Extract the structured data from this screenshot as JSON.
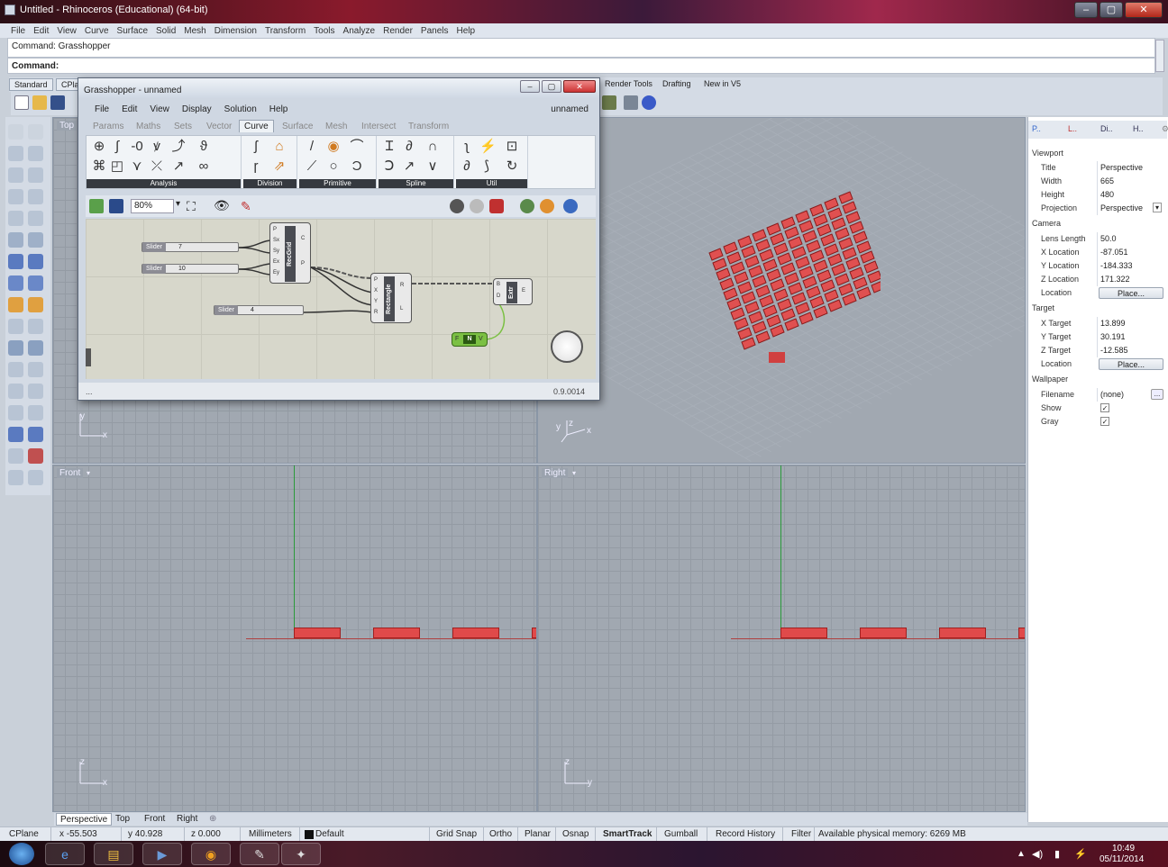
{
  "window": {
    "title": "Untitled - Rhinoceros (Educational) (64-bit)",
    "min": "–",
    "max": "▢",
    "close": "✕"
  },
  "menu": [
    "File",
    "Edit",
    "View",
    "Curve",
    "Surface",
    "Solid",
    "Mesh",
    "Dimension",
    "Transform",
    "Tools",
    "Analyze",
    "Render",
    "Panels",
    "Help"
  ],
  "command": {
    "history": "Command: Grasshopper",
    "prompt": "Command:"
  },
  "toolbar_tabs": {
    "standard": "Standard",
    "cplanes": "CPla",
    "render_tools": "Render Tools",
    "drafting": "Drafting",
    "new_v5": "New in V5"
  },
  "viewports": {
    "top": {
      "label": "Top",
      "ax_y": "y",
      "ax_x": "x"
    },
    "perspective": {
      "ax_z": "z",
      "ax_y": "y",
      "ax_x": "x"
    },
    "front": {
      "label": "Front",
      "ax_z": "z",
      "ax_x": "x"
    },
    "right": {
      "label": "Right",
      "ax_z": "z",
      "ax_y": "y"
    }
  },
  "grasshopper": {
    "title": "Grasshopper - unnamed",
    "doc": "unnamed",
    "menu": [
      "File",
      "Edit",
      "View",
      "Display",
      "Solution",
      "Help"
    ],
    "tabs": [
      "Params",
      "Maths",
      "Sets",
      "Vector",
      "Curve",
      "Surface",
      "Mesh",
      "Intersect",
      "Transform"
    ],
    "active_tab": "Curve",
    "groups": [
      "Analysis",
      "Division",
      "Primitive",
      "Spline",
      "Util"
    ],
    "zoom": "80%",
    "version": "0.9.0014",
    "status_left": "...",
    "sliders": [
      {
        "label": "Slider",
        "value": "7"
      },
      {
        "label": "Slider",
        "value": "10"
      },
      {
        "label": "Slider",
        "value": "4"
      }
    ],
    "components": {
      "recgrid": {
        "name": "RecGrid",
        "inputs": [
          "P",
          "Sx",
          "Sy",
          "Ex",
          "Ey"
        ],
        "outputs": [
          "C",
          "P"
        ]
      },
      "rectangle": {
        "name": "Rectangle",
        "inputs": [
          "P",
          "X",
          "Y",
          "R"
        ],
        "outputs": [
          "R",
          "L"
        ]
      },
      "extr": {
        "name": "Extr",
        "inputs": [
          "B",
          "D"
        ],
        "outputs": [
          "E"
        ]
      },
      "vector": {
        "name": "N",
        "inputs": [
          "F"
        ],
        "outputs": [
          "V"
        ]
      }
    }
  },
  "properties": {
    "tabs": [
      "P..",
      "L..",
      "Di..",
      "H.."
    ],
    "viewport_section": "Viewport",
    "viewport": [
      {
        "k": "Title",
        "v": "Perspective"
      },
      {
        "k": "Width",
        "v": "665"
      },
      {
        "k": "Height",
        "v": "480"
      },
      {
        "k": "Projection",
        "v": "Perspective"
      }
    ],
    "camera_section": "Camera",
    "camera": [
      {
        "k": "Lens Length",
        "v": "50.0"
      },
      {
        "k": "X Location",
        "v": "-87.051"
      },
      {
        "k": "Y Location",
        "v": "-184.333"
      },
      {
        "k": "Z Location",
        "v": "171.322"
      }
    ],
    "camera_location": {
      "k": "Location",
      "btn": "Place..."
    },
    "target_section": "Target",
    "target": [
      {
        "k": "X Target",
        "v": "13.899"
      },
      {
        "k": "Y Target",
        "v": "30.191"
      },
      {
        "k": "Z Target",
        "v": "-12.585"
      }
    ],
    "target_location": {
      "k": "Location",
      "btn": "Place..."
    },
    "wallpaper_section": "Wallpaper",
    "wallpaper": {
      "filename_k": "Filename",
      "filename_v": "(none)",
      "browse": "...",
      "show": "Show",
      "gray": "Gray",
      "check": "✓"
    }
  },
  "viewport_tabs": [
    "Perspective",
    "Top",
    "Front",
    "Right"
  ],
  "status": {
    "cplane": "CPlane",
    "x": "x -55.503",
    "y": "y 40.928",
    "z": "z 0.000",
    "units": "Millimeters",
    "layer": "Default",
    "toggles": [
      "Grid Snap",
      "Ortho",
      "Planar",
      "Osnap",
      "SmartTrack",
      "Gumball",
      "Record History",
      "Filter"
    ],
    "memory": "Available physical memory: 6269 MB"
  },
  "clock": {
    "time": "10:49",
    "date": "05/11/2014"
  },
  "colors": {
    "accent_red": "#e04a4a",
    "viewport_bg": "#a1a8b1"
  }
}
